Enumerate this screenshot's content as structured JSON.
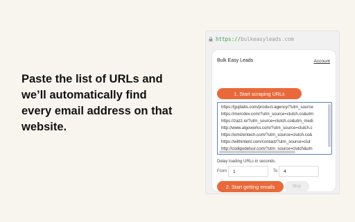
{
  "headline": {
    "lines": [
      "Paste the list of URLs and",
      "we’ll automatically find",
      "every email address on that",
      "website."
    ]
  },
  "browser": {
    "url_scheme": "https://",
    "url_host": "bulkeasyleads.com"
  },
  "extension": {
    "brand": "Bulk Easy Leads",
    "account_link": "Account",
    "scrape_button": "1. Start scraping URLs",
    "urls": [
      "https://gojilabs.com/product-agency/?utm_source",
      "https://mercdev.com/?utm_source=clutch.co&utm",
      "https://zazz.io/?utm_source=clutch.co&utm_medi",
      "http://www.algoworks.com/?utm_source=clutch.c",
      "https://emizentech.com/?utm_source=clutch.co&",
      "https://withintent.com/contact/?utm_source=clut",
      "http://codigodelsur.com/?utm_source=clutch&utn"
    ],
    "delay_label": "Delay loading URLs in seconds.",
    "from_label": "From",
    "from_value": "1",
    "to_label": "To",
    "to_value": "4",
    "emails_button": "2. Start getting emails",
    "stop_button": "Stop"
  },
  "colors": {
    "accent": "#e9693a",
    "background": "#f7f5ee",
    "textarea_focus": "#5b7fc7",
    "url_scheme": "#3e9b45"
  }
}
